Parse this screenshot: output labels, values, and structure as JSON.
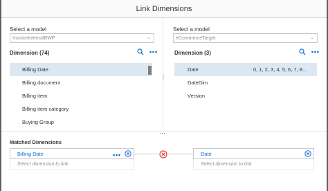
{
  "dialog": {
    "title": "Link Dimensions"
  },
  "left": {
    "select_label": "Select a model",
    "select_value": "InvoiceInternalBWP",
    "dimension_header": "Dimension  (74)",
    "items": [
      {
        "label": "Billing Date",
        "selected": true
      },
      {
        "label": "Billing document"
      },
      {
        "label": "Billing item"
      },
      {
        "label": "Billing item category"
      },
      {
        "label": "Buying Group"
      }
    ]
  },
  "right": {
    "select_label": "Select a model",
    "select_value": "eCommerceTarget",
    "dimension_header": "Dimension  (3)",
    "items": [
      {
        "label": "Date",
        "values": "0, 1, 2, 3, 4, 5, 6, 7, 8...",
        "selected": true
      },
      {
        "label": "DateDim"
      },
      {
        "label": "Version"
      }
    ]
  },
  "matched": {
    "title": "Matched Dimensions",
    "left_value": "Billing Date",
    "right_value": "Date",
    "placeholder": "Select dimension to link"
  },
  "colors": {
    "accent": "#0a6ed1",
    "selected_bg": "#dbe8f3",
    "unlink": "#e33d3d"
  }
}
